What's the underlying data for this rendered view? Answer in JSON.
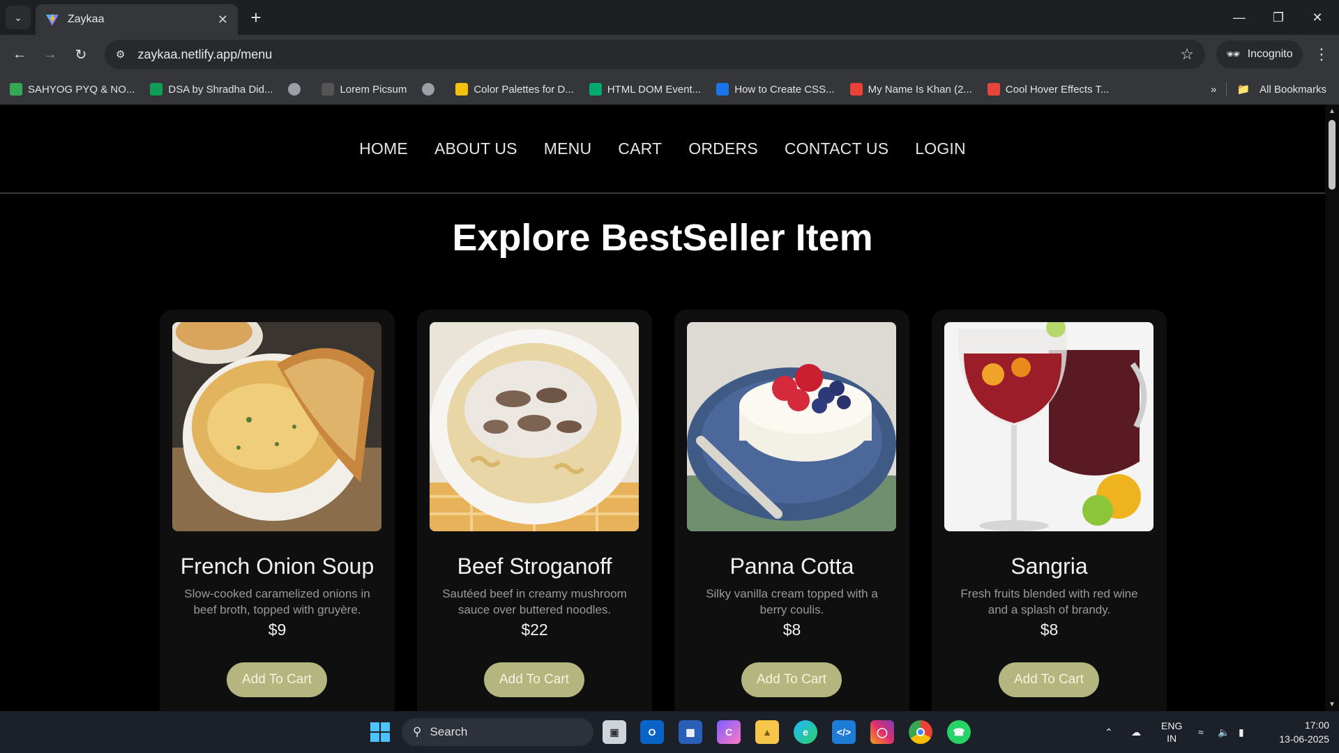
{
  "browser": {
    "tab_title": "Zaykaa",
    "url": "zaykaa.netlify.app/menu",
    "incognito_label": "Incognito",
    "bookmarks": [
      {
        "label": "SAHYOG PYQ & NO...",
        "icon": "drive-icon",
        "color": "#34a853"
      },
      {
        "label": "DSA by Shradha Did...",
        "icon": "sheets-icon",
        "color": "#0f9d58"
      },
      {
        "label": "",
        "icon": "globe-icon",
        "color": "#9aa0a6"
      },
      {
        "label": "Lorem Picsum",
        "icon": "picsum-icon",
        "color": "#555555"
      },
      {
        "label": "",
        "icon": "globe-icon",
        "color": "#9aa0a6"
      },
      {
        "label": "Color Palettes for D...",
        "icon": "palette-icon",
        "color": "#f4c20d"
      },
      {
        "label": "HTML DOM Event...",
        "icon": "w3-icon",
        "color": "#04aa6d"
      },
      {
        "label": "How to Create CSS...",
        "icon": "at-icon",
        "color": "#1a73e8"
      },
      {
        "label": "My Name Is Khan (2...",
        "icon": "google-icon",
        "color": "#ea4335"
      },
      {
        "label": "Cool Hover Effects T...",
        "icon": "asterisk-icon",
        "color": "#e8453c"
      }
    ],
    "all_bookmarks_label": "All Bookmarks"
  },
  "site": {
    "nav": [
      "HOME",
      "ABOUT US",
      "MENU",
      "CART",
      "ORDERS",
      "CONTACT US",
      "LOGIN"
    ],
    "heading": "Explore BestSeller Item",
    "add_label": "Add To Cart",
    "items": [
      {
        "name": "French Onion Soup",
        "desc": "Slow-cooked caramelized onions in beef broth, topped with gruyère.",
        "price": "$9",
        "image": "french-onion-soup-photo"
      },
      {
        "name": "Beef Stroganoff",
        "desc": "Sautéed beef in creamy mushroom sauce over buttered noodles.",
        "price": "$22",
        "image": "beef-stroganoff-photo"
      },
      {
        "name": "Panna Cotta",
        "desc": "Silky vanilla cream topped with a berry coulis.",
        "price": "$8",
        "image": "panna-cotta-photo"
      },
      {
        "name": "Sangria",
        "desc": "Fresh fruits blended with red wine and a splash of brandy.",
        "price": "$8",
        "image": "sangria-photo"
      }
    ],
    "colors": {
      "background": "#000000",
      "card": "#0f0f0f",
      "button": "#b5b57f"
    }
  },
  "taskbar": {
    "search_label": "Search",
    "lang_top": "ENG",
    "lang_bottom": "IN",
    "time": "17:00",
    "date": "13-06-2025"
  }
}
